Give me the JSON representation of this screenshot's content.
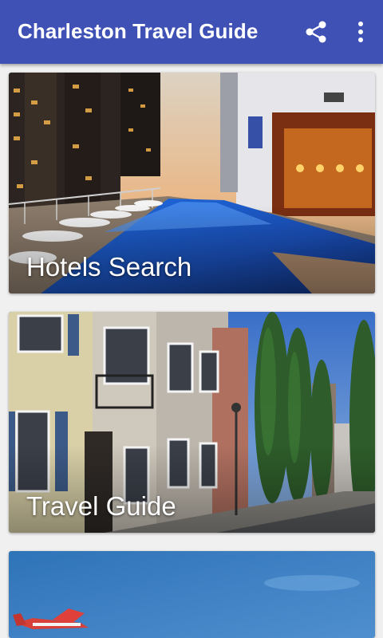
{
  "app_bar": {
    "title": "Charleston Travel Guide",
    "icons": [
      "share-icon",
      "more-vert-icon"
    ],
    "color": "#3f51b5"
  },
  "cards": [
    {
      "label": "Hotels Search",
      "image": "hotel rooftop pool at sunset"
    },
    {
      "label": "Travel Guide",
      "image": "historic Charleston street with row houses"
    },
    {
      "label": "",
      "image": "blue sky with red plane"
    }
  ]
}
